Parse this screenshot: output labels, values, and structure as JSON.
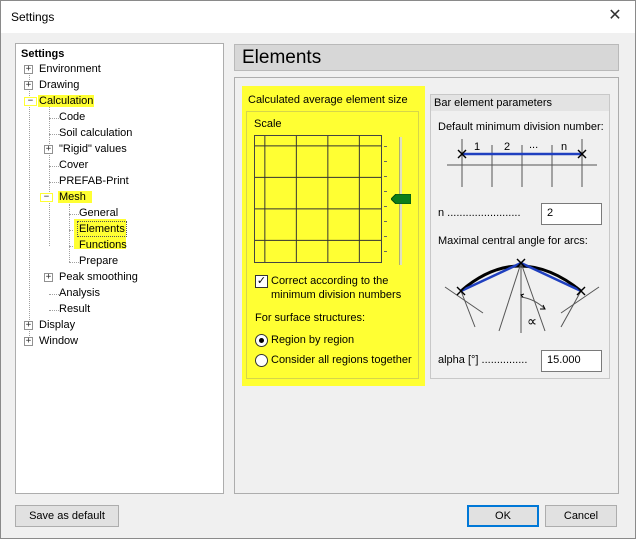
{
  "window": {
    "title": "Settings",
    "close_glyph": "✕"
  },
  "tree": {
    "root": "Settings",
    "items": [
      {
        "label": "Environment",
        "expander": "+"
      },
      {
        "label": "Drawing",
        "expander": "+"
      },
      {
        "label": "Calculation",
        "expander": "−",
        "highlighted": true
      },
      {
        "label": "Code"
      },
      {
        "label": "Soil calculation"
      },
      {
        "label": "\"Rigid\" values",
        "expander": "+"
      },
      {
        "label": "Cover"
      },
      {
        "label": "PREFAB-Print"
      },
      {
        "label": "Mesh",
        "expander": "−",
        "highlighted": true
      },
      {
        "label": "General"
      },
      {
        "label": "Elements",
        "highlighted": true,
        "selected": true
      },
      {
        "label": "Functions"
      },
      {
        "label": "Prepare"
      },
      {
        "label": "Peak smoothing",
        "expander": "+"
      },
      {
        "label": "Analysis"
      },
      {
        "label": "Result"
      },
      {
        "label": "Display",
        "expander": "+"
      },
      {
        "label": "Window",
        "expander": "+"
      }
    ]
  },
  "page": {
    "title": "Elements"
  },
  "avg_group": {
    "title": "Calculated average element size",
    "scale_label": "Scale",
    "checkbox_label": "Correct according to the minimum division numbers",
    "checkbox_checked": true,
    "surface_label": "For surface structures:",
    "radio1": "Region by region",
    "radio2": "Consider all regions together",
    "selected_radio": "Region by region",
    "highlight_color": "#ffff33"
  },
  "bar_group": {
    "title": "Bar element parameters",
    "div_label": "Default minimum division number:",
    "diagram_labels": [
      "1",
      "2",
      "...",
      "n"
    ],
    "n_label": "n ........................",
    "n_value": "2",
    "arc_label": "Maximal central angle for arcs:",
    "angle_symbol": "∝",
    "alpha_label": "alpha [°] ...............",
    "alpha_value": "15.000",
    "accent_color": "#1f3fbf"
  },
  "buttons": {
    "save_default": "Save as default",
    "ok": "OK",
    "cancel": "Cancel"
  }
}
